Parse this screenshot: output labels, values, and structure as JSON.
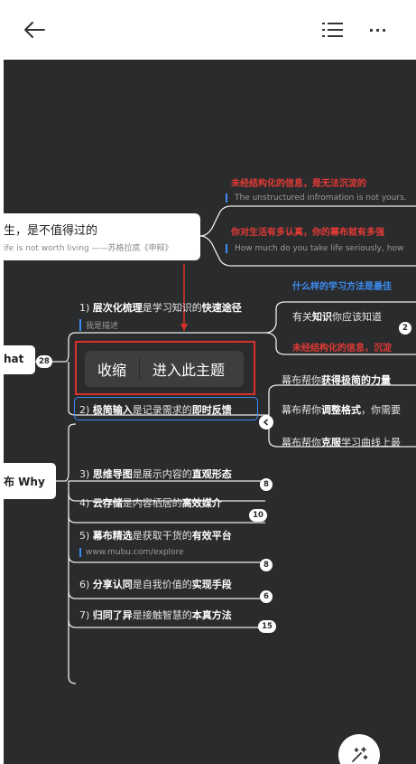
{
  "header": {
    "back_icon": "arrow-left-icon",
    "outline_icon": "list-icon",
    "more_label": "···"
  },
  "root_left": {
    "text": "生，是不值得过的",
    "sub": "ife is not worth living ——苏格拉底《申辩》"
  },
  "red_branch": [
    {
      "text": "未经结构化的信息，是无法沉淀的",
      "sub": "The unstructured infromation is not yours."
    },
    {
      "text": "你对生活有多认真，你的幕布就有多强",
      "sub": "How much do you take life seriously, how"
    }
  ],
  "what_node": {
    "label": "hat",
    "count": "28"
  },
  "why_node": {
    "label": "布 Why"
  },
  "right_blue": "什么样的学习方法是最佳",
  "right_nodes": [
    {
      "pre": "有关",
      "bold": "知识",
      "post": "你应该知道"
    },
    {
      "text": "未经结构化的信息，沉淀"
    }
  ],
  "right_badge": "2",
  "mubu_power": {
    "pre": "幕布帮你",
    "bold": "获得极简的力量"
  },
  "mubu_nodes": [
    {
      "pre": "幕布帮你",
      "bold": "调整格式",
      "post": "，你需要"
    },
    {
      "pre": "幕布帮你",
      "bold": "克服",
      "post": "学习曲线上最"
    }
  ],
  "collapse_icon": "chevron-left-icon",
  "items": [
    {
      "num": "1)",
      "b1": "层次化梳理",
      "m": "是学习知识的",
      "b2": "快速途径",
      "sub": "我是描述"
    },
    {
      "num": "2)",
      "b1": "极简输入",
      "m": "是记录需求的",
      "b2": "即时反馈"
    },
    {
      "num": "3)",
      "b1": "思维导图",
      "m": "是展示内容的",
      "b2": "直观形态",
      "count": "8"
    },
    {
      "num": "4)",
      "b1": "云存储",
      "m": "是内容栖居的",
      "b2": "高效媒介",
      "count": "10"
    },
    {
      "num": "5)",
      "b1": "幕布精选",
      "m": "是获取干货的",
      "b2": "有效平台",
      "sub": "www.mubu.com/explore",
      "count": "8"
    },
    {
      "num": "6)",
      "b1": "分享认同",
      "m": "是自我价值的",
      "b2": "实现手段",
      "count": "6"
    },
    {
      "num": "7)",
      "b1": "归同了异",
      "m": "是接触智慧的",
      "b2": "本真方法",
      "count": "15"
    }
  ],
  "popup": {
    "collapse": "收缩",
    "enter": "进入此主题"
  },
  "fab_icon": "magic-wand-icon"
}
